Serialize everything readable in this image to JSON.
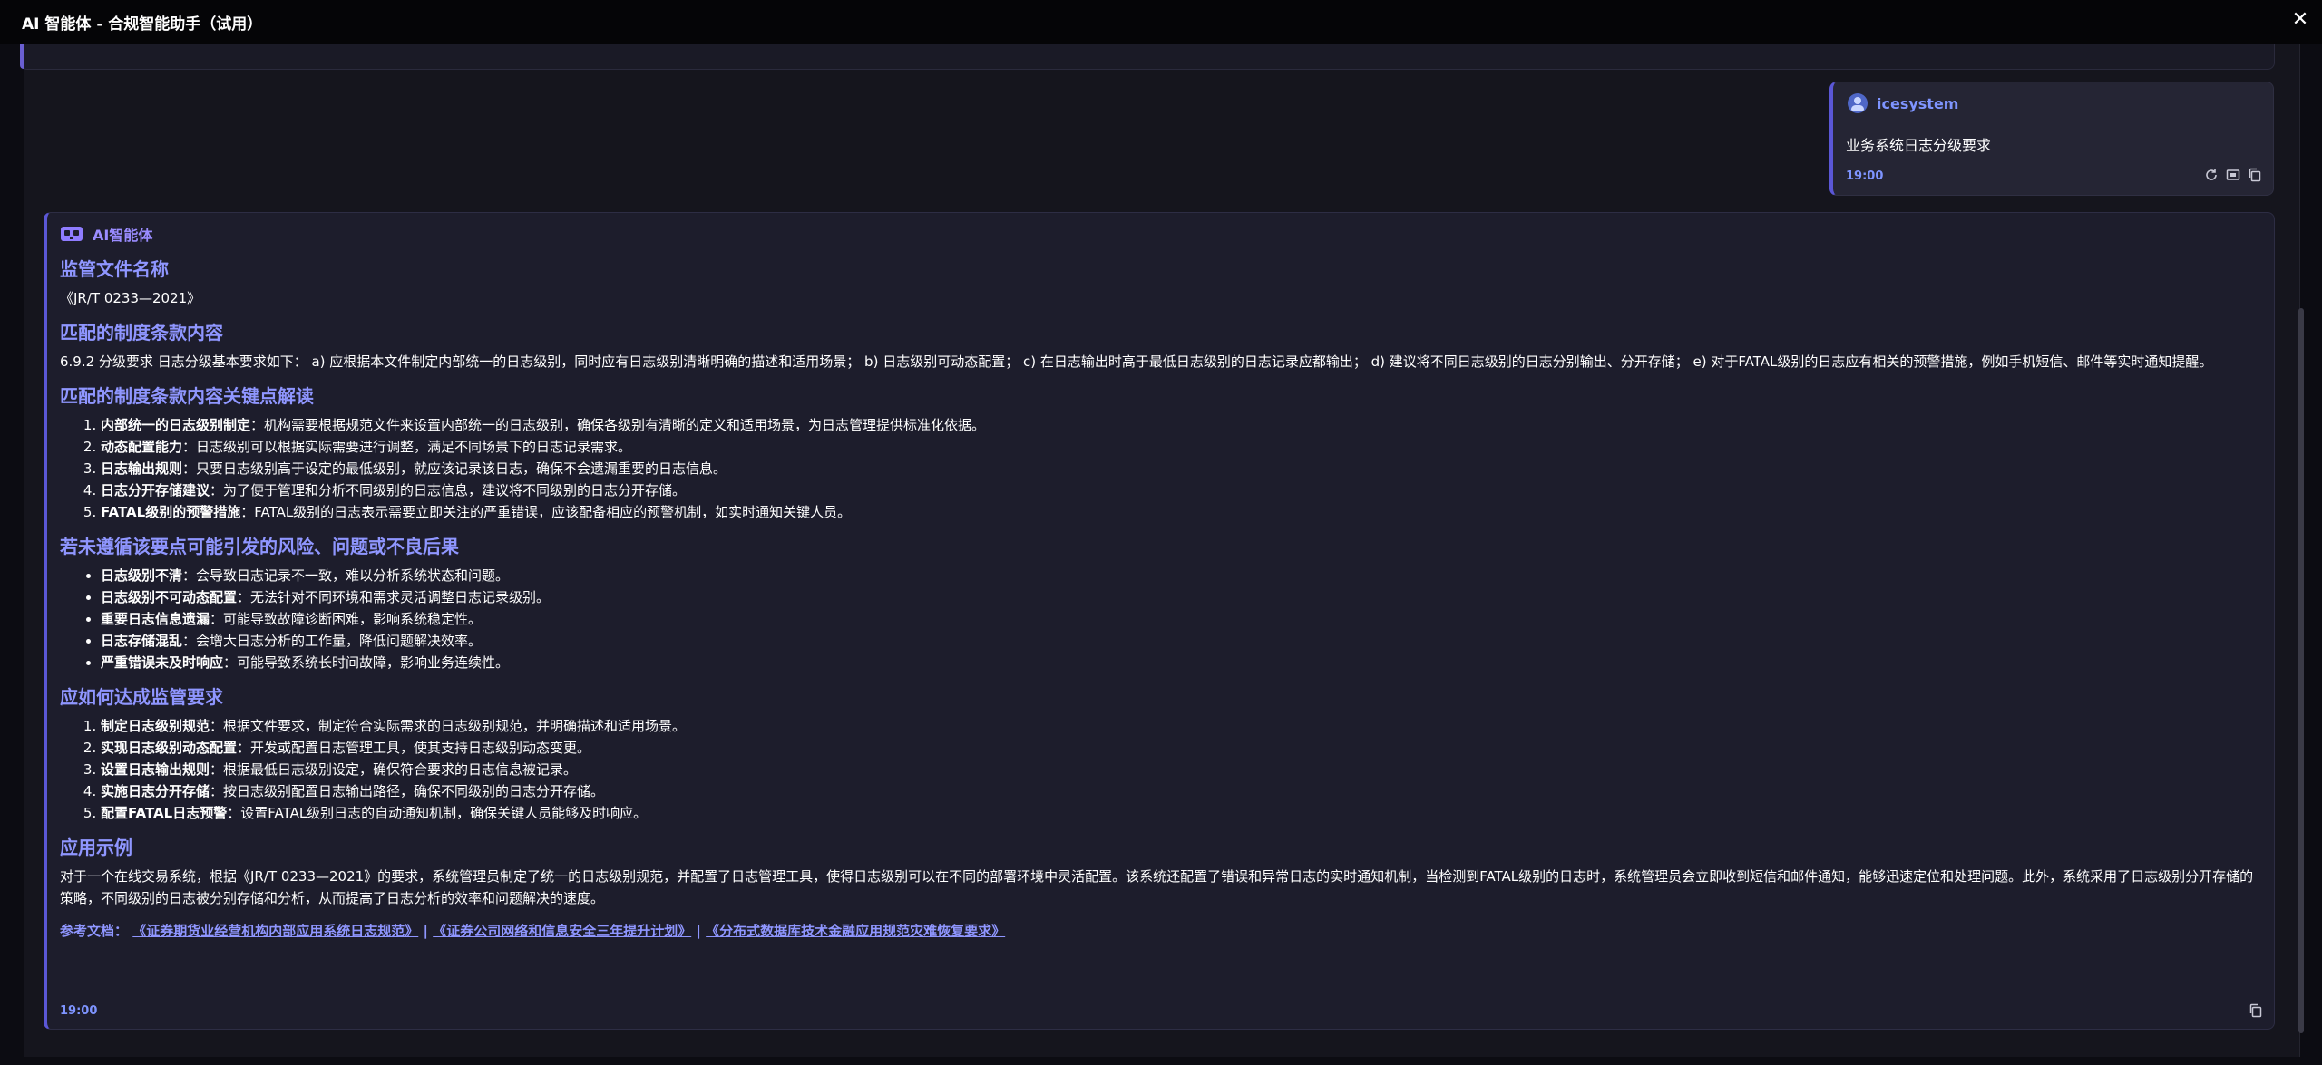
{
  "window": {
    "title": "AI 智能体 - 合规智能助手（试用）",
    "close_symbol": "✕"
  },
  "user_message": {
    "username": "icesystem",
    "text": "业务系统日志分级要求",
    "time": "19:00",
    "actions": [
      "refresh-icon",
      "screen-icon",
      "copy-icon"
    ]
  },
  "ai_message": {
    "sender": "AI智能体",
    "icon": "robot-icon",
    "time": "19:00",
    "sections": {
      "doc_title": "监管文件名称",
      "doc_name": "《JR/T 0233—2021》",
      "clause_title": "匹配的制度条款内容",
      "clause_text": "6.9.2 分级要求 日志分级基本要求如下： a) 应根据本文件制定内部统一的日志级别，同时应有日志级别清晰明确的描述和适用场景； b) 日志级别可动态配置； c) 在日志输出时高于最低日志级别的日志记录应都输出； d) 建议将不同日志级别的日志分别输出、分开存储； e) 对于FATAL级别的日志应有相关的预警措施，例如手机短信、邮件等实时通知提醒。",
      "keypoints_title": "匹配的制度条款内容关键点解读",
      "keypoints": [
        {
          "term": "内部统一的日志级别制定",
          "desc": "：机构需要根据规范文件来设置内部统一的日志级别，确保各级别有清晰的定义和适用场景，为日志管理提供标准化依据。"
        },
        {
          "term": "动态配置能力",
          "desc": "：日志级别可以根据实际需要进行调整，满足不同场景下的日志记录需求。"
        },
        {
          "term": "日志输出规则",
          "desc": "：只要日志级别高于设定的最低级别，就应该记录该日志，确保不会遗漏重要的日志信息。"
        },
        {
          "term": "日志分开存储建议",
          "desc": "：为了便于管理和分析不同级别的日志信息，建议将不同级别的日志分开存储。"
        },
        {
          "term": "FATAL级别的预警措施",
          "desc": "：FATAL级别的日志表示需要立即关注的严重错误，应该配备相应的预警机制，如实时通知关键人员。"
        }
      ],
      "risks_title": "若未遵循该要点可能引发的风险、问题或不良后果",
      "risks": [
        {
          "term": "日志级别不清",
          "desc": "：会导致日志记录不一致，难以分析系统状态和问题。"
        },
        {
          "term": "日志级别不可动态配置",
          "desc": "：无法针对不同环境和需求灵活调整日志记录级别。"
        },
        {
          "term": "重要日志信息遗漏",
          "desc": "：可能导致故障诊断困难，影响系统稳定性。"
        },
        {
          "term": "日志存储混乱",
          "desc": "：会增大日志分析的工作量，降低问题解决效率。"
        },
        {
          "term": "严重错误未及时响应",
          "desc": "：可能导致系统长时间故障，影响业务连续性。"
        }
      ],
      "howto_title": "应如何达成监管要求",
      "howto": [
        {
          "term": "制定日志级别规范",
          "desc": "：根据文件要求，制定符合实际需求的日志级别规范，并明确描述和适用场景。"
        },
        {
          "term": "实现日志级别动态配置",
          "desc": "：开发或配置日志管理工具，使其支持日志级别动态变更。"
        },
        {
          "term": "设置日志输出规则",
          "desc": "：根据最低日志级别设定，确保符合要求的日志信息被记录。"
        },
        {
          "term": "实施日志分开存储",
          "desc": "：按日志级别配置日志输出路径，确保不同级别的日志分开存储。"
        },
        {
          "term": "配置FATAL日志预警",
          "desc": "：设置FATAL级别日志的自动通知机制，确保关键人员能够及时响应。"
        }
      ],
      "example_title": "应用示例",
      "example_text": "对于一个在线交易系统，根据《JR/T 0233—2021》的要求，系统管理员制定了统一的日志级别规范，并配置了日志管理工具，使得日志级别可以在不同的部署环境中灵活配置。该系统还配置了错误和异常日志的实时通知机制，当检测到FATAL级别的日志时，系统管理员会立即收到短信和邮件通知，能够迅速定位和处理问题。此外，系统采用了日志级别分开存储的策略，不同级别的日志被分别存储和分析，从而提高了日志分析的效率和问题解决的速度。"
    },
    "references": {
      "label": "参考文档：",
      "separator": " | ",
      "items": [
        "《证券期货业经营机构内部应用系统日志规范》",
        "《证券公司网络和信息安全三年提升计划》",
        "《分布式数据库技术金融应用规范灾难恢复要求》"
      ]
    }
  },
  "colors": {
    "accent": "#8f96ff",
    "user_name": "#7e94ff",
    "card_border": "#5b57d6"
  }
}
